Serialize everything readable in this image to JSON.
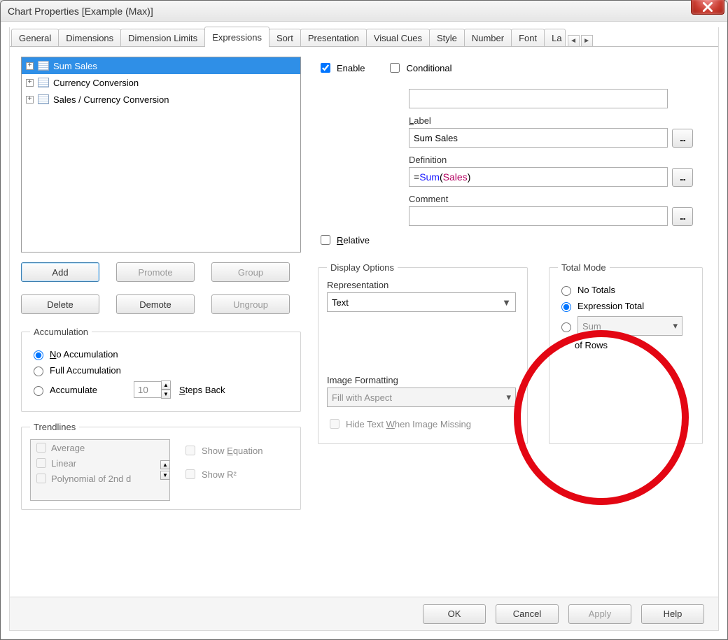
{
  "title": "Chart Properties [Example (Max)]",
  "tabs": [
    "General",
    "Dimensions",
    "Dimension Limits",
    "Expressions",
    "Sort",
    "Presentation",
    "Visual Cues",
    "Style",
    "Number",
    "Font",
    "La"
  ],
  "active_tab": 3,
  "expressions": {
    "items": [
      "Sum Sales",
      "Currency Conversion",
      "Sales / Currency Conversion"
    ],
    "selected": 0
  },
  "btns": {
    "add": "Add",
    "promote": "Promote",
    "group": "Group",
    "delete": "Delete",
    "demote": "Demote",
    "ungroup": "Ungroup"
  },
  "accumulation": {
    "legend": "Accumulation",
    "no": "No Accumulation",
    "full": "Full Accumulation",
    "acc": "Accumulate",
    "steps": "10",
    "steps_label": "Steps Back",
    "selected": "no"
  },
  "trend": {
    "legend": "Trendlines",
    "items": [
      "Average",
      "Linear",
      "Polynomial of 2nd d"
    ],
    "show_eq": "Show Equation",
    "show_r2": "Show R²"
  },
  "right": {
    "enable": "Enable",
    "conditional": "Conditional",
    "relative": "Relative",
    "enable_checked": true,
    "conditional_checked": false,
    "relative_checked": false,
    "label_lbl": "Label",
    "label_val": "Sum Sales",
    "comment_lbl": "Comment",
    "definition_lbl": "Definition",
    "def_parts": {
      "eq": "=",
      "fn": "Sum",
      "open": "(",
      "field": "Sales",
      "close": ")"
    },
    "fx": "..."
  },
  "display": {
    "legend": "Display Options",
    "rep_lbl": "Representation",
    "rep_val": "Text",
    "imgfmt_lbl": "Image Formatting",
    "imgfmt_val": "Fill with Aspect",
    "hide_img": "Hide Text When Image Missing"
  },
  "total": {
    "legend": "Total Mode",
    "no": "No Totals",
    "expr": "Expression Total",
    "mode_val": "Sum",
    "of_rows": "of Rows",
    "selected": "expr"
  },
  "footer": {
    "ok": "OK",
    "cancel": "Cancel",
    "apply": "Apply",
    "help": "Help"
  }
}
